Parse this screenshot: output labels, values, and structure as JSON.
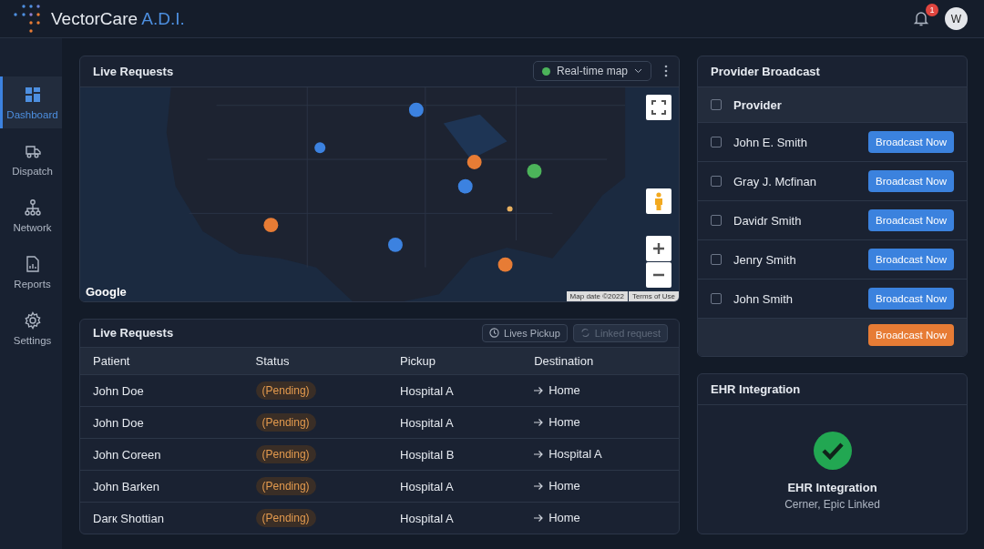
{
  "header": {
    "brand": "VectorCare",
    "brand_accent": "A.D.I.",
    "notifications": "1",
    "avatar": "W"
  },
  "sidebar": {
    "items": [
      {
        "label": "Dashboard",
        "selected": true
      },
      {
        "label": "Dispatch",
        "selected": false
      },
      {
        "label": "Network",
        "selected": false
      },
      {
        "label": "Reports",
        "selected": false
      },
      {
        "label": "Settings",
        "selected": false
      }
    ]
  },
  "map_card": {
    "title": "Live Requests",
    "view_select": "Real-time map",
    "map": {
      "kind": "picture",
      "logo": "Google",
      "map_date": "Map date ©2022",
      "terms": "Terms of Use"
    }
  },
  "requests_card": {
    "title": "Live Requests",
    "buttons": [
      {
        "label": "Lives Pickup",
        "disabled": false
      },
      {
        "label": "Linked request",
        "disabled": true
      }
    ],
    "columns": [
      "Patient",
      "Status",
      "Pickup",
      "Destination"
    ],
    "rows": [
      {
        "patient": "John Doe",
        "status": "(Pending)",
        "pickup": "Hospital A",
        "destination": "Home"
      },
      {
        "patient": "John Doe",
        "status": "(Pending)",
        "pickup": "Hospital A",
        "destination": "Home"
      },
      {
        "patient": "John Coreen",
        "status": "(Pending)",
        "pickup": "Hospital B",
        "destination": "Hospital A"
      },
      {
        "patient": "John Barken",
        "status": "(Pending)",
        "pickup": "Hospital A",
        "destination": "Home"
      },
      {
        "patient": "Darк Shottian",
        "status": "(Pending)",
        "pickup": "Hospital A",
        "destination": "Home"
      }
    ]
  },
  "provider_card": {
    "title": "Provider Broadcast",
    "header": {
      "label": "Provider",
      "checked": false
    },
    "providers": [
      {
        "name": "John E. Smith",
        "checked": false,
        "action": "Broadcast Now"
      },
      {
        "name": "Gray J. Mcfinan",
        "checked": false,
        "action": "Broadcast Now"
      },
      {
        "name": "Davidr Smith",
        "checked": false,
        "action": "Broadcast Now"
      },
      {
        "name": "Jenry Smith",
        "checked": false,
        "action": "Broadcast Now"
      },
      {
        "name": "John Smith",
        "checked": false,
        "action": "Broadcast Now"
      }
    ],
    "footer_action": "Broadcast Now"
  },
  "ehr_card": {
    "title": "EHR Integration",
    "status_title": "EHR Integration",
    "status_detail": "Cerner, Epic Linked"
  }
}
